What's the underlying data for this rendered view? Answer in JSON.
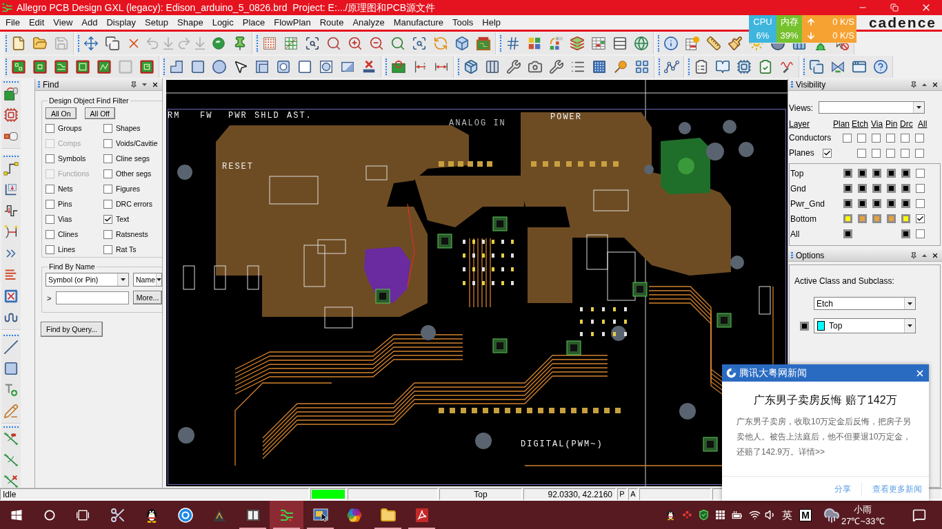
{
  "window": {
    "title": "Allegro PCB Design GXL (legacy): Edison_arduino_5_0826.brd  Project: E:.../原理图和PCB源文件"
  },
  "menu": [
    "File",
    "Edit",
    "View",
    "Add",
    "Display",
    "Setup",
    "Shape",
    "Logic",
    "Place",
    "FlowPlan",
    "Route",
    "Analyze",
    "Manufacture",
    "Tools",
    "Help"
  ],
  "brand": "cadence",
  "net_monitor": {
    "cpu": {
      "label": "CPU",
      "value": "6%"
    },
    "memory": {
      "label": "内存",
      "value": "39%"
    },
    "upload": "0 K/S",
    "download": "0 K/S"
  },
  "toolbar_rows": [
    {
      "groups": [
        {
          "buttons": [
            {
              "disabled": false
            },
            {
              "disabled": false
            },
            {
              "disabled": true
            }
          ]
        },
        {
          "buttons": [
            {
              "disabled": false
            },
            {
              "disabled": false
            },
            {
              "disabled": false
            },
            {
              "disabled": true
            },
            {
              "disabled": true
            },
            {
              "disabled": true
            },
            {
              "disabled": true
            },
            {
              "disabled": false
            },
            {
              "disabled": false
            }
          ]
        },
        {
          "buttons": [
            {
              "disabled": false
            },
            {
              "disabled": false
            },
            {
              "disabled": false
            },
            {
              "disabled": false
            },
            {
              "disabled": false
            },
            {
              "disabled": false
            },
            {
              "disabled": false
            },
            {
              "disabled": false
            },
            {
              "disabled": false
            },
            {
              "disabled": false
            },
            {
              "disabled": false
            }
          ]
        },
        {
          "buttons": [
            {
              "disabled": false
            },
            {
              "disabled": false
            },
            {
              "disabled": false
            },
            {
              "disabled": false
            },
            {
              "disabled": false
            },
            {
              "disabled": false
            },
            {
              "disabled": false
            }
          ]
        },
        {
          "buttons": [
            {
              "disabled": false
            },
            {
              "disabled": false
            },
            {
              "disabled": false
            },
            {
              "disabled": false
            },
            {
              "disabled": false
            },
            {
              "disabled": false
            },
            {
              "disabled": false
            },
            {
              "disabled": false
            },
            {
              "disabled": false
            }
          ]
        }
      ]
    },
    {
      "groups": [
        {
          "buttons": [
            {
              "disabled": false
            },
            {
              "disabled": false
            },
            {
              "disabled": false
            },
            {
              "disabled": false
            },
            {
              "disabled": false
            },
            {
              "disabled": true
            },
            {
              "disabled": false
            }
          ]
        },
        {
          "buttons": [
            {
              "disabled": false
            },
            {
              "disabled": false
            },
            {
              "disabled": false
            },
            {
              "disabled": false
            },
            {
              "disabled": false
            },
            {
              "disabled": false
            },
            {
              "disabled": false
            },
            {
              "disabled": false
            },
            {
              "disabled": false
            },
            {
              "disabled": false
            }
          ]
        },
        {
          "buttons": [
            {
              "disabled": false
            },
            {
              "disabled": false
            },
            {
              "disabled": false
            }
          ]
        },
        {
          "buttons": [
            {
              "disabled": false
            },
            {
              "disabled": false
            },
            {
              "disabled": false
            },
            {
              "disabled": false
            },
            {
              "disabled": false
            },
            {
              "disabled": false
            },
            {
              "disabled": false
            },
            {
              "disabled": false
            },
            {
              "disabled": false
            }
          ]
        },
        {
          "buttons": [
            {
              "disabled": false
            }
          ]
        },
        {
          "buttons": [
            {
              "disabled": false
            },
            {
              "disabled": false
            },
            {
              "disabled": false
            },
            {
              "disabled": false
            },
            {
              "disabled": false
            }
          ]
        },
        {
          "buttons": [
            {
              "disabled": false
            },
            {
              "disabled": false
            },
            {
              "disabled": false
            },
            {
              "disabled": false
            }
          ]
        }
      ]
    }
  ],
  "find_panel": {
    "title": "Find",
    "filter": {
      "title": "Design Object Find Filter",
      "buttons": [
        "All On",
        "All Off"
      ],
      "items": [
        {
          "label": "Groups",
          "checked": false,
          "disabled": false
        },
        {
          "label": "Shapes",
          "checked": false,
          "disabled": false
        },
        {
          "label": "Comps",
          "checked": false,
          "disabled": true
        },
        {
          "label": "Voids/Cavitie",
          "checked": false,
          "disabled": false
        },
        {
          "label": "Symbols",
          "checked": false,
          "disabled": false
        },
        {
          "label": "Cline segs",
          "checked": false,
          "disabled": false
        },
        {
          "label": "Functions",
          "checked": false,
          "disabled": true
        },
        {
          "label": "Other segs",
          "checked": false,
          "disabled": false
        },
        {
          "label": "Nets",
          "checked": false,
          "disabled": false
        },
        {
          "label": "Figures",
          "checked": false,
          "disabled": false
        },
        {
          "label": "Pins",
          "checked": false,
          "disabled": false
        },
        {
          "label": "DRC errors",
          "checked": false,
          "disabled": false
        },
        {
          "label": "Vias",
          "checked": false,
          "disabled": false
        },
        {
          "label": "Text",
          "checked": true,
          "disabled": false
        },
        {
          "label": "Clines",
          "checked": false,
          "disabled": false
        },
        {
          "label": "Ratsnests",
          "checked": false,
          "disabled": false
        },
        {
          "label": "Lines",
          "checked": false,
          "disabled": false
        },
        {
          "label": "Rat Ts",
          "checked": false,
          "disabled": false
        }
      ]
    },
    "by_name": {
      "title": "Find By Name",
      "object_type": "Symbol (or Pin)",
      "match_mode": "Name",
      "prompt": ">",
      "more_button": "More..."
    },
    "query_button": "Find by Query..."
  },
  "board_labels": [
    "RM",
    "FW",
    "PWR",
    "SHLD",
    "AST.",
    "RESET",
    "ANALOG IN",
    "POWER",
    "DIGITAL(PWM~)"
  ],
  "visibility_panel": {
    "title": "Visibility",
    "views_label": "Views:",
    "columns": [
      "Layer",
      "Plan",
      "Etch",
      "Via",
      "Pin",
      "Drc",
      "All"
    ],
    "classes": [
      {
        "label": "Conductors",
        "cells": [
          {
            "kind": "checkbox",
            "checked": false
          },
          {
            "kind": "checkbox",
            "checked": false
          },
          {
            "kind": "checkbox",
            "checked": false
          },
          {
            "kind": "checkbox",
            "checked": false
          },
          {
            "kind": "checkbox",
            "checked": false
          },
          {
            "kind": "checkbox",
            "checked": false
          }
        ]
      },
      {
        "label": "Planes",
        "toggle": {
          "checked": true
        },
        "cells": [
          {
            "kind": "blank"
          },
          {
            "kind": "checkbox",
            "checked": false
          },
          {
            "kind": "checkbox",
            "checked": false
          },
          {
            "kind": "checkbox",
            "checked": false
          },
          {
            "kind": "checkbox",
            "checked": false
          },
          {
            "kind": "checkbox",
            "checked": false
          }
        ]
      }
    ],
    "layers": [
      {
        "label": "Top",
        "cells": [
          {
            "kind": "swatch",
            "color": "#000000"
          },
          {
            "kind": "swatch",
            "color": "#000000"
          },
          {
            "kind": "swatch",
            "color": "#000000"
          },
          {
            "kind": "swatch",
            "color": "#000000"
          },
          {
            "kind": "swatch",
            "color": "#000000"
          },
          {
            "kind": "checkbox",
            "checked": false
          }
        ]
      },
      {
        "label": "Gnd",
        "cells": [
          {
            "kind": "swatch",
            "color": "#000000"
          },
          {
            "kind": "swatch",
            "color": "#000000"
          },
          {
            "kind": "swatch",
            "color": "#000000"
          },
          {
            "kind": "swatch",
            "color": "#000000"
          },
          {
            "kind": "swatch",
            "color": "#000000"
          },
          {
            "kind": "checkbox",
            "checked": false
          }
        ]
      },
      {
        "label": "Pwr_Gnd",
        "cells": [
          {
            "kind": "swatch",
            "color": "#000000"
          },
          {
            "kind": "swatch",
            "color": "#000000"
          },
          {
            "kind": "swatch",
            "color": "#000000"
          },
          {
            "kind": "swatch",
            "color": "#000000"
          },
          {
            "kind": "swatch",
            "color": "#000000"
          },
          {
            "kind": "checkbox",
            "checked": false
          }
        ]
      },
      {
        "label": "Bottom",
        "cells": [
          {
            "kind": "swatch",
            "color": "#ffff00"
          },
          {
            "kind": "swatch",
            "color": "#e8a040"
          },
          {
            "kind": "swatch",
            "color": "#e8a040"
          },
          {
            "kind": "swatch",
            "color": "#e8a040"
          },
          {
            "kind": "swatch",
            "color": "#ffff00"
          },
          {
            "kind": "checkbox",
            "checked": true
          }
        ]
      },
      {
        "label": "All",
        "cells": [
          {
            "kind": "swatch",
            "color": "#000000"
          },
          {
            "kind": "blank"
          },
          {
            "kind": "blank"
          },
          {
            "kind": "blank"
          },
          {
            "kind": "swatch",
            "color": "#000000"
          },
          {
            "kind": "checkbox",
            "checked": false
          }
        ]
      }
    ]
  },
  "options_panel": {
    "title": "Options",
    "caption": "Active Class and Subclass:",
    "class": "Etch",
    "subclass": {
      "value": "Top",
      "color": "#00ffff"
    },
    "subclass_swatch": {
      "color": "#000000"
    }
  },
  "status_bar": {
    "message": "Idle",
    "busy": false,
    "layer": "Top",
    "coordinates": "92.0330, 42.2160",
    "toggles": [
      "P",
      "A"
    ]
  },
  "notification": {
    "source": "腾讯大粤网新闻",
    "headline": "广东男子卖房反悔 赔了142万",
    "body": "广东男子卖房，收取10万定金后反悔，把房子另卖他人。被告上法庭后，他不但要退10万定金，还赔了142.9万。详情>>",
    "actions": [
      "分享",
      "查看更多新闻"
    ]
  },
  "taskbar": {
    "apps": [
      {
        "running": false,
        "selected": false
      },
      {
        "running": false,
        "selected": false
      },
      {
        "running": false,
        "selected": false
      },
      {
        "running": false,
        "selected": false
      },
      {
        "running": true,
        "selected": false
      },
      {
        "running": true,
        "selected": true
      },
      {
        "running": true,
        "selected": false
      },
      {
        "running": false,
        "selected": false
      },
      {
        "running": true,
        "selected": false
      },
      {
        "running": true,
        "selected": false
      }
    ],
    "tray": {
      "language": "英",
      "input_mode": "M",
      "weather": "小雨",
      "temperature": "27℃~33℃"
    }
  }
}
